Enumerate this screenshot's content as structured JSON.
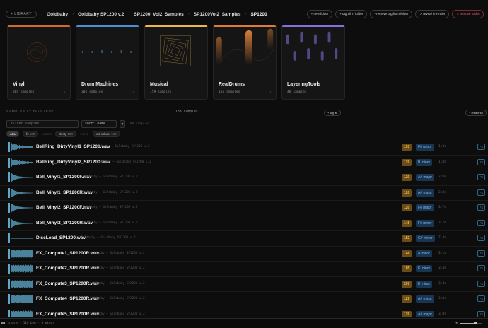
{
  "breadcrumb": {
    "library": "+ LIBRARY",
    "items": [
      "Goldbaby",
      "Goldbaby SP1200 v.2",
      "SP1200_Vol2_Samples",
      "SP1200Vol2_Samples",
      "SP1200"
    ]
  },
  "actions": {
    "new_folder": "+ new folder",
    "tag_all": "+ tag all in folder",
    "remove_tag": "- remove tag from folder",
    "reveal": "↗ reveal in Finder",
    "remove_folder": "✕ remove folder"
  },
  "cards": [
    {
      "name": "Vinyl",
      "count": "304 samples",
      "color": "#d36a2c"
    },
    {
      "name": "Drum Machines",
      "count": "301 samples",
      "color": "#4a8fd4"
    },
    {
      "name": "Musical",
      "count": "159 samples",
      "color": "#e8b84a"
    },
    {
      "name": "RealDrums",
      "count": "155 samples",
      "color": "#e07a3a"
    },
    {
      "name": "LayeringTools",
      "count": "48 samples",
      "color": "#8a6ee0"
    }
  ],
  "level": {
    "label": "SAMPLES AT THIS LEVEL",
    "count": "188 samples",
    "tag_all": "+ tag all",
    "create_kit": "+ create kit"
  },
  "filter": {
    "placeholder": "filter samples...",
    "sort": "sort: name",
    "sort_dir": "▼",
    "count": "188 samples"
  },
  "tags": {
    "all": "ALL",
    "fx": {
      "name": "fx",
      "count": "100"
    },
    "mood_label": "MOOD",
    "dusty": {
      "name": "dusty",
      "count": "188"
    },
    "tone_label": "TONE",
    "old_school": {
      "name": "old school",
      "count": "188"
    }
  },
  "rows": [
    {
      "name": "BellRing_DirtyVinyl1_SP1200.wav",
      "sub": "Goldbaby — Goldbaby SP1200 v.2",
      "bpm": "191",
      "key": "F# minor",
      "dur": "1.3s",
      "fx": "FX"
    },
    {
      "name": "BellRing_DirtyVinyl2_SP1200.wav",
      "sub": "Goldbaby — Goldbaby SP1200 v.2",
      "bpm": "129",
      "key": "B minor",
      "dur": "1.8s",
      "fx": "FX"
    },
    {
      "name": "Bell_Vinyl1_SP1200F.wav",
      "sub": "Goldbaby — Goldbaby SP1200 v.2",
      "bpm": "120",
      "key": "A# major",
      "dur": "3.8s",
      "fx": "FX"
    },
    {
      "name": "Bell_Vinyl1_SP1200R.wav",
      "sub": "Goldbaby — Goldbaby SP1200 v.2",
      "bpm": "120",
      "key": "A# major",
      "dur": "3.8s",
      "fx": "FX"
    },
    {
      "name": "Bell_Vinyl2_SP1200F.wav",
      "sub": "Goldbaby — Goldbaby SP1200 v.2",
      "bpm": "120",
      "key": "F# major",
      "dur": "3.7s",
      "fx": "FX"
    },
    {
      "name": "Bell_Vinyl2_SP1200R.wav",
      "sub": "Goldbaby — Goldbaby SP1200 v.2",
      "bpm": "148",
      "key": "F# minor",
      "dur": "3.7s",
      "fx": "FX"
    },
    {
      "name": "DiscLoad_SP1200.wav",
      "sub": "Goldbaby — Goldbaby SP1200 v.2",
      "bpm": "152",
      "key": "G# minor",
      "dur": "7.4s",
      "fx": "FX"
    },
    {
      "name": "FX_Compute1_SP1200R.wav",
      "sub": "Goldbaby — Goldbaby SP1200 v.2",
      "bpm": "148",
      "key": "A minor",
      "dur": "3.1s",
      "fx": "FX"
    },
    {
      "name": "FX_Compute2_SP1200R.wav",
      "sub": "Goldbaby — Goldbaby SP1200 v.2",
      "bpm": "185",
      "key": "E minor",
      "dur": "3.4s",
      "fx": "FX"
    },
    {
      "name": "FX_Compute3_SP1200R.wav",
      "sub": "Goldbaby — Goldbaby SP1200 v.2",
      "bpm": "207",
      "key": "E minor",
      "dur": "3.4s",
      "fx": "FX"
    },
    {
      "name": "FX_Compute4_SP1200R.wav",
      "sub": "Goldbaby — Goldbaby SP1200 v.2",
      "bpm": "129",
      "key": "A# minor",
      "dur": "3.8s",
      "fx": "FX"
    },
    {
      "name": "FX_Compute5_SP1200R.wav",
      "sub": "Goldbaby — Goldbaby SP1200 v.2",
      "bpm": "129",
      "key": "A# major",
      "dur": "3.8s",
      "fx": "FX"
    }
  ],
  "footer": {
    "prefix": "av",
    "info": "snare · 110 bpm · D minor",
    "volume": 0.7
  }
}
